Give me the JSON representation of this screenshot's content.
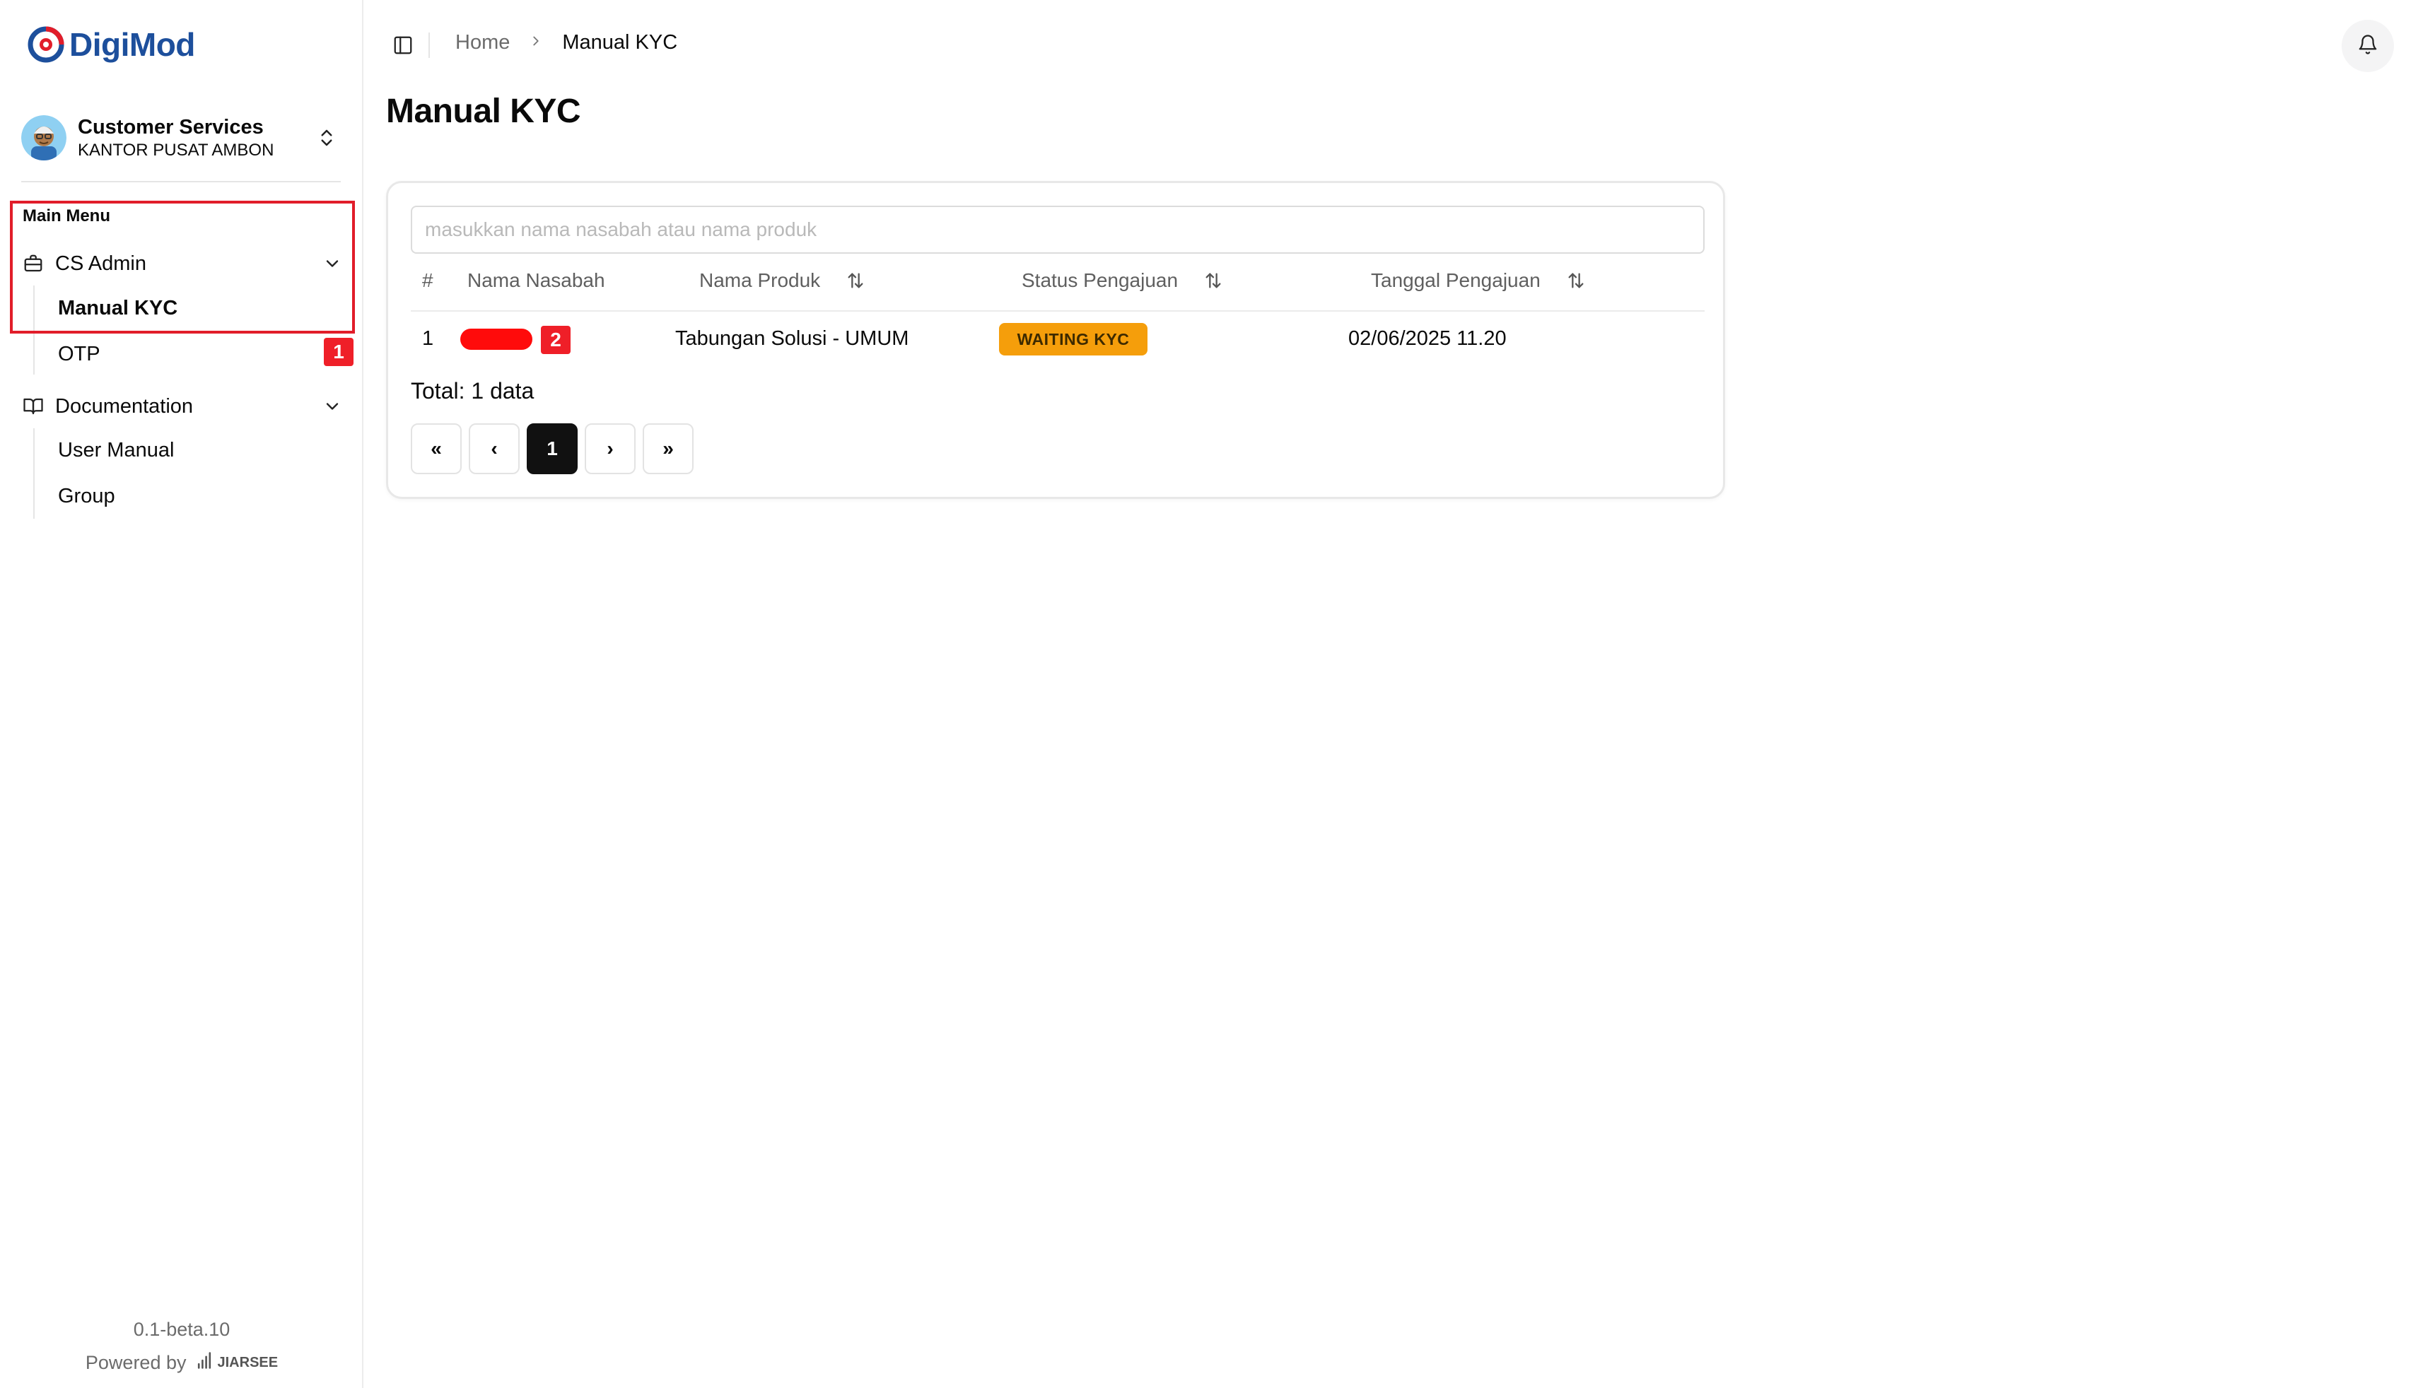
{
  "app": {
    "name": "DigiMod"
  },
  "user": {
    "role": "Customer Services",
    "branch": "KANTOR PUSAT AMBON"
  },
  "sidebar": {
    "group_label": "Main Menu",
    "cs_admin": {
      "label": "CS Admin",
      "items": [
        {
          "label": "Manual KYC",
          "active": true
        },
        {
          "label": "OTP",
          "active": false
        }
      ]
    },
    "documentation": {
      "label": "Documentation",
      "items": [
        {
          "label": "User Manual"
        },
        {
          "label": "Group"
        }
      ]
    }
  },
  "annotations": {
    "badge_1": "1",
    "badge_2": "2"
  },
  "footer": {
    "version": "0.1-beta.10",
    "powered_by": "Powered by",
    "brand": "JIARSEE"
  },
  "breadcrumb": {
    "home": "Home",
    "current": "Manual KYC"
  },
  "page": {
    "title": "Manual KYC"
  },
  "search": {
    "placeholder": "masukkan nama nasabah atau nama produk",
    "value": ""
  },
  "table": {
    "columns": [
      "#",
      "Nama Nasabah",
      "Nama Produk",
      "Status Pengajuan",
      "Tanggal Pengajuan"
    ],
    "rows": [
      {
        "no": "1",
        "nama_nasabah": "",
        "nama_produk": "Tabungan Solusi - UMUM",
        "status": "WAITING KYC",
        "tanggal": "02/06/2025 11.20"
      }
    ],
    "total": "Total: 1 data"
  },
  "pagination": {
    "first": "«",
    "prev": "‹",
    "current": "1",
    "next": "›",
    "last": "»"
  },
  "colors": {
    "brand": "#1d4f9c",
    "status_waiting": "#f59e0b",
    "annotation_red": "#ef1f28"
  }
}
